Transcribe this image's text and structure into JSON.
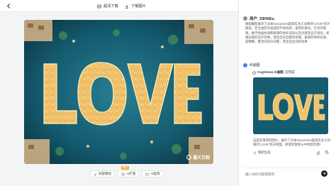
{
  "topbar": {
    "original_label": "超清下载",
    "download_label": "下载图片"
  },
  "canvas": {
    "title_text": "LOVE",
    "watermark": "通义万相"
  },
  "tools": [
    {
      "label": "局部重绘",
      "icon": "brush-icon"
    },
    {
      "label": "AI扩图",
      "icon": "expand-icon"
    },
    {
      "label": "AI超清",
      "icon": "hd-icon"
    }
  ],
  "tools_badge": "限免",
  "chat": {
    "username": "用户_33HXEu",
    "prompt": "微观摄影展示了日本maruimichi超现实主义风格的“LOVE”花卉图案，完全由花卉组成的字体形状，柔和的黄光，空灵的氛围，数字绘画色调和鲜艳的色彩渲染以及灵感来自于阳光、机械光照的设计效果，营造出有创意的氛围，柔和的体积光源，是精细，繁茂的花卉间距，营造出生动的效果",
    "ai_title": "AI画图",
    "model_line": "CogView4 AI画图",
    "status": "已完成",
    "result_text": "这是您请求的图片，展示了日本maruimichi超现实主义风格的“LOVE”花卉图案。希望您能够从中找到灵感！",
    "regen_label": "重新生成"
  },
  "input": {
    "placeholder": "输入你的问题或需求"
  }
}
